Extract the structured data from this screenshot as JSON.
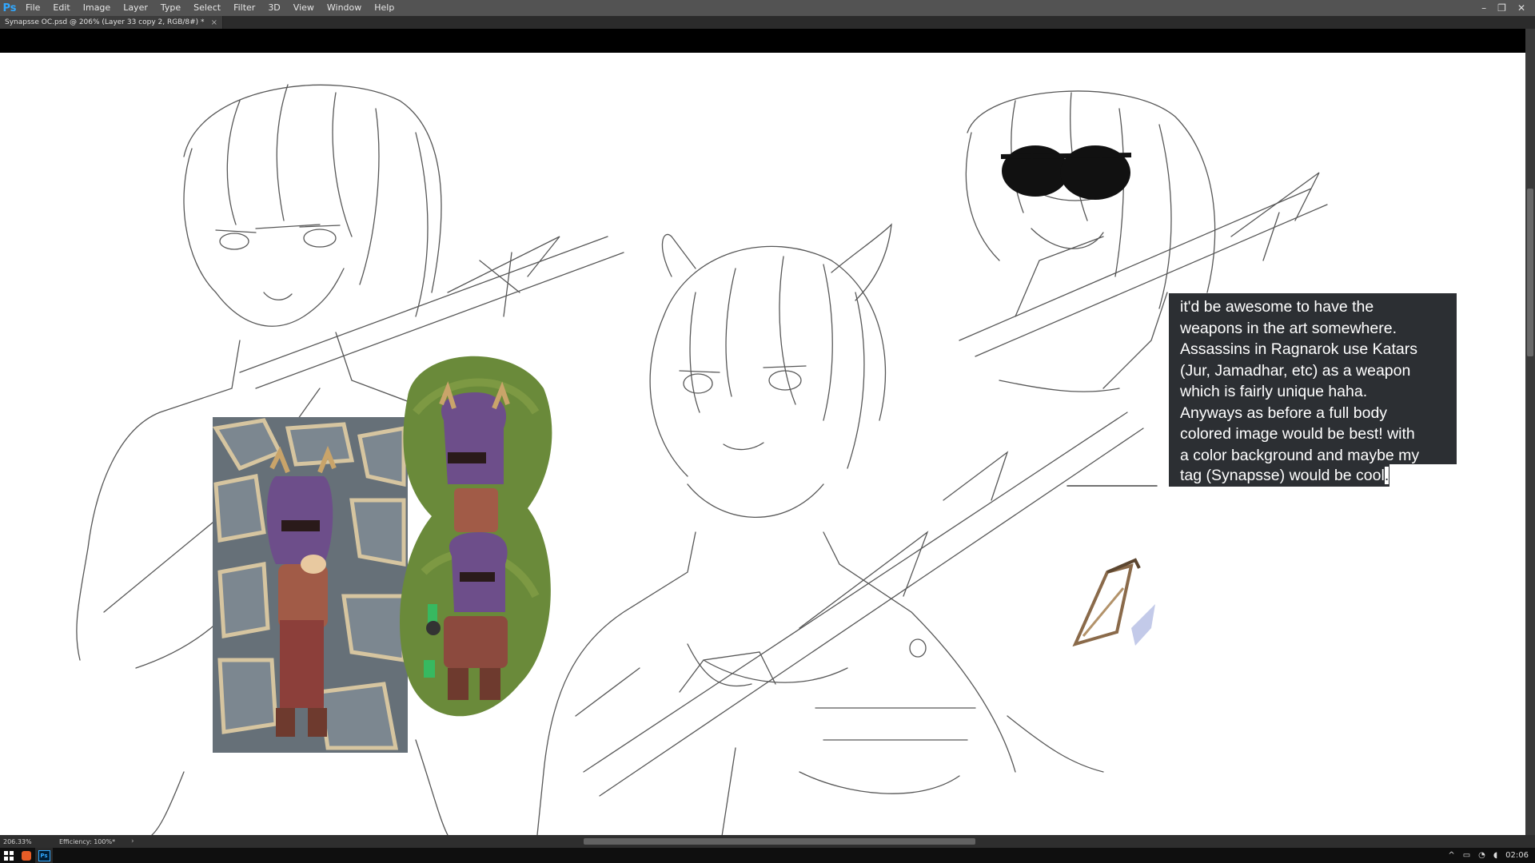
{
  "app": {
    "logo": "Ps",
    "menu": [
      "File",
      "Edit",
      "Image",
      "Layer",
      "Type",
      "Select",
      "Filter",
      "3D",
      "View",
      "Window",
      "Help"
    ],
    "window_controls": {
      "minimize": "–",
      "restore": "❐",
      "close": "✕"
    }
  },
  "document_tab": {
    "title": "Synapsse OC.psd @ 206% (Layer 33 copy 2, RGB/8#) *",
    "close": "×"
  },
  "canvas": {
    "background": "#ffffff",
    "textbox_lines": [
      "it'd be awesome to have the",
      "weapons in the art somewhere.",
      "Assassins in Ragnarok use Katars",
      "(Jur, Jamadhar, etc) as a weapon",
      "which is fairly unique haha.",
      "Anyways as before a full body",
      "colored image would be best! with",
      "a color background and maybe my"
    ],
    "textbox_last_line": "tag (Synapsse) would be cool",
    "textbox_cursor_char": "."
  },
  "status": {
    "zoom": "206.33%",
    "efficiency": "Efficiency: 100%*",
    "arrow": "›"
  },
  "taskbar": {
    "clock": "02:06",
    "tray_up": "^"
  },
  "colors": {
    "menubar": "#535353",
    "accent": "#31a8ff",
    "textbox_bg": "#2c2f33"
  }
}
